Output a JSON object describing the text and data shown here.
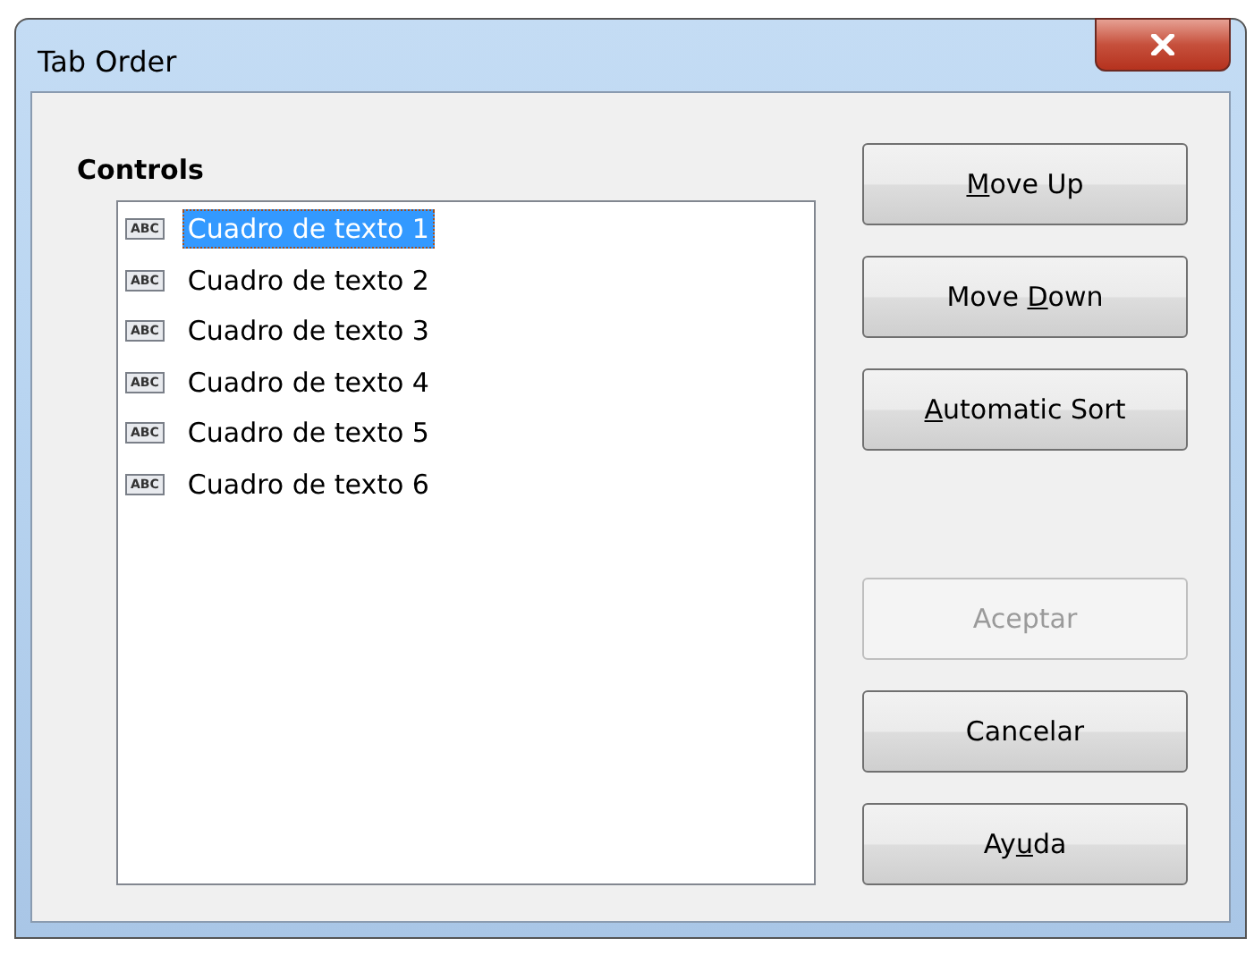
{
  "window": {
    "title": "Tab Order"
  },
  "controls": {
    "label": "Controls",
    "items": [
      {
        "icon_text": "ABC",
        "label": "Cuadro de texto 1",
        "selected": true
      },
      {
        "icon_text": "ABC",
        "label": "Cuadro de texto 2",
        "selected": false
      },
      {
        "icon_text": "ABC",
        "label": "Cuadro de texto 3",
        "selected": false
      },
      {
        "icon_text": "ABC",
        "label": "Cuadro de texto 4",
        "selected": false
      },
      {
        "icon_text": "ABC",
        "label": "Cuadro de texto 5",
        "selected": false
      },
      {
        "icon_text": "ABC",
        "label": "Cuadro de texto 6",
        "selected": false
      }
    ]
  },
  "order_buttons": [
    {
      "key": "M",
      "post": "ove Up",
      "disabled": false
    },
    {
      "pre": "Move ",
      "key": "D",
      "post": "own",
      "disabled": false
    },
    {
      "key": "A",
      "post": "utomatic Sort",
      "disabled": false
    }
  ],
  "dialog_buttons": [
    {
      "pre": "Aceptar",
      "disabled": true
    },
    {
      "pre": "Cancelar",
      "disabled": false
    },
    {
      "pre": "Ay",
      "key": "u",
      "post": "da",
      "disabled": false
    }
  ]
}
